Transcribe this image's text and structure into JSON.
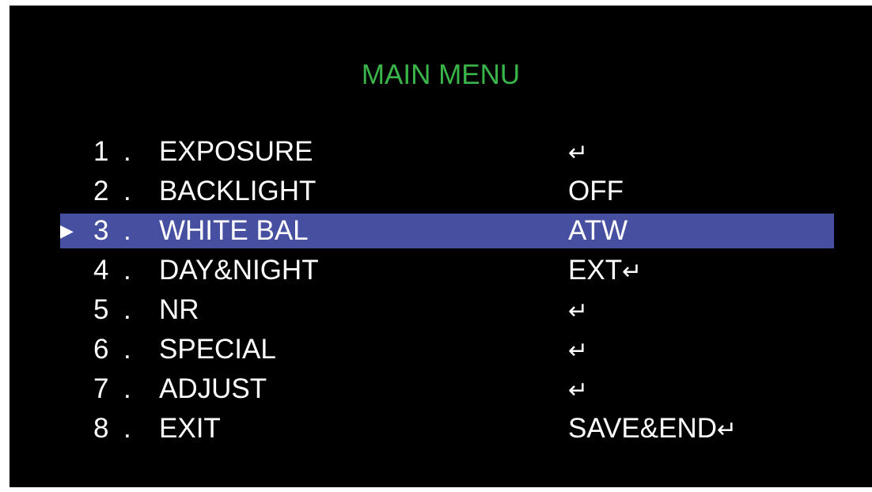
{
  "menu": {
    "title": "MAIN MENU",
    "cursor_symbol": "▶",
    "enter_symbol": "↵",
    "items": [
      {
        "num": "1",
        "sep": ".",
        "label": "EXPOSURE",
        "value": "",
        "has_enter": true
      },
      {
        "num": "2",
        "sep": ".",
        "label": "BACKLIGHT",
        "value": "OFF",
        "has_enter": false
      },
      {
        "num": "3",
        "sep": ".",
        "label": "WHITE BAL",
        "value": "ATW",
        "has_enter": false,
        "selected": true
      },
      {
        "num": "4",
        "sep": ".",
        "label": "DAY&NIGHT",
        "value": "EXT",
        "has_enter": true
      },
      {
        "num": "5",
        "sep": ".",
        "label": "NR",
        "value": "",
        "has_enter": true
      },
      {
        "num": "6",
        "sep": ".",
        "label": "SPECIAL",
        "value": "",
        "has_enter": true
      },
      {
        "num": "7",
        "sep": ".",
        "label": "ADJUST",
        "value": "",
        "has_enter": true
      },
      {
        "num": "8",
        "sep": ".",
        "label": "EXIT",
        "value": "SAVE&END",
        "has_enter": true
      }
    ]
  },
  "colors": {
    "background": "#000000",
    "title": "#3ab54a",
    "text": "#ffffff",
    "selection": "#4750a0"
  }
}
